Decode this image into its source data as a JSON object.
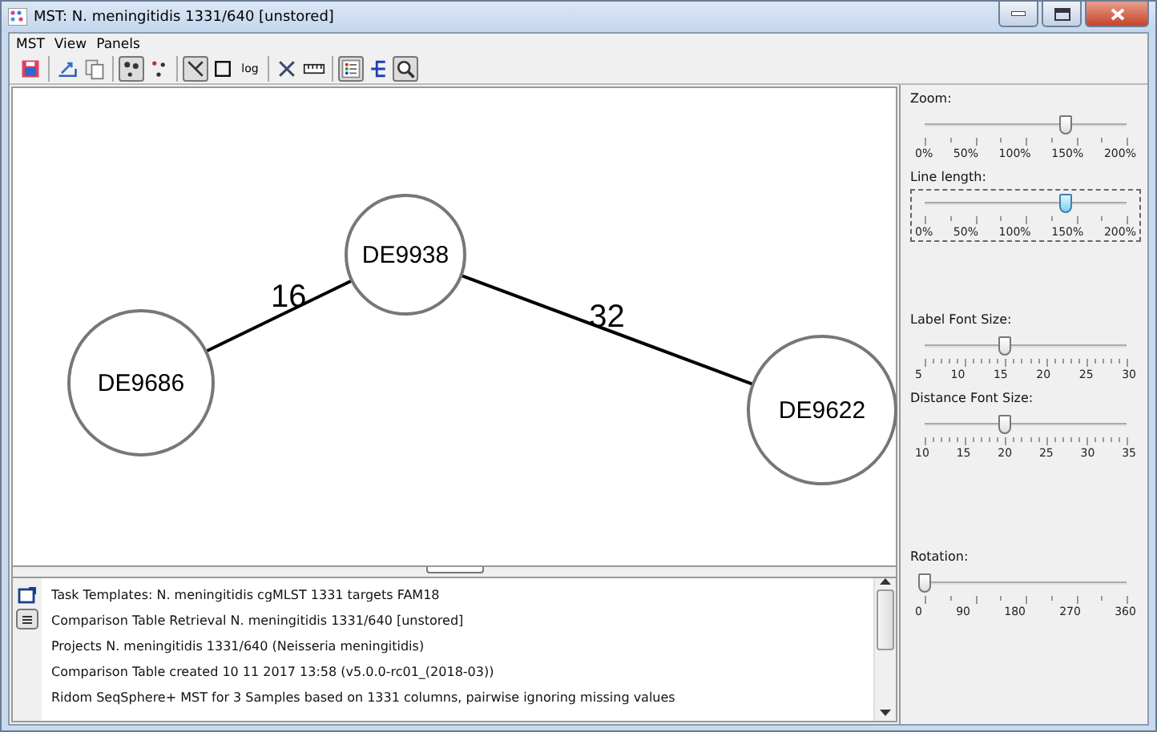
{
  "window": {
    "title": "MST: N. meningitidis 1331/640 [unstored]"
  },
  "menu": [
    "MST",
    "View",
    "Panels"
  ],
  "toolbar": [
    [
      {
        "kind": "print",
        "selected": false
      }
    ],
    [
      {
        "kind": "export",
        "selected": false
      },
      {
        "kind": "copy",
        "selected": false
      }
    ],
    [
      {
        "kind": "nodes",
        "selected": true
      },
      {
        "kind": "scatter",
        "selected": false
      }
    ],
    [
      {
        "kind": "edges",
        "selected": true
      },
      {
        "kind": "square",
        "selected": false
      },
      {
        "kind": "text",
        "label": "log",
        "selected": false
      }
    ],
    [
      {
        "kind": "scissors",
        "selected": false
      },
      {
        "kind": "ruler",
        "selected": false
      }
    ],
    [
      {
        "kind": "legend",
        "selected": true
      },
      {
        "kind": "tree",
        "selected": false
      },
      {
        "kind": "zoom",
        "selected": true
      }
    ]
  ],
  "graph": {
    "nodes": [
      {
        "label": "DE9938"
      },
      {
        "label": "DE9686"
      },
      {
        "label": "DE9622"
      }
    ],
    "edges": [
      {
        "label": "16"
      },
      {
        "label": "32"
      }
    ]
  },
  "log": [
    "Task Templates: N. meningitidis cgMLST 1331 targets FAM18",
    "Comparison Table Retrieval  N. meningitidis 1331/640 [unstored]",
    "Projects  N. meningitidis 1331/640 (Neisseria meningitidis)",
    "Comparison Table created  10 11 2017 13:58 (v5.0.0-rc01_(2018-03))",
    "Ridom SeqSphere+ MST for 3 Samples based on 1331 columns, pairwise ignoring missing values"
  ],
  "sliders": [
    {
      "label": "Zoom:",
      "level": 0.7,
      "focused": false,
      "minor": false,
      "ticks": [
        "0%",
        "50%",
        "100%",
        "150%",
        "200%"
      ]
    },
    {
      "label": "Line length:",
      "level": 0.7,
      "focused": true,
      "minor": false,
      "ticks": [
        "0%",
        "50%",
        "100%",
        "150%",
        "200%"
      ]
    },
    {
      "label": "Label Font Size:",
      "level": 0.4,
      "focused": false,
      "minor": true,
      "ticks": [
        "5",
        "10",
        "15",
        "20",
        "25",
        "30"
      ]
    },
    {
      "label": "Distance Font Size:",
      "level": 0.4,
      "focused": false,
      "minor": true,
      "ticks": [
        "10",
        "15",
        "20",
        "25",
        "30",
        "35"
      ]
    },
    {
      "label": "Rotation:",
      "level": 0,
      "focused": false,
      "minor": false,
      "ticks": [
        "0",
        "90",
        "180",
        "270",
        "360"
      ]
    }
  ]
}
